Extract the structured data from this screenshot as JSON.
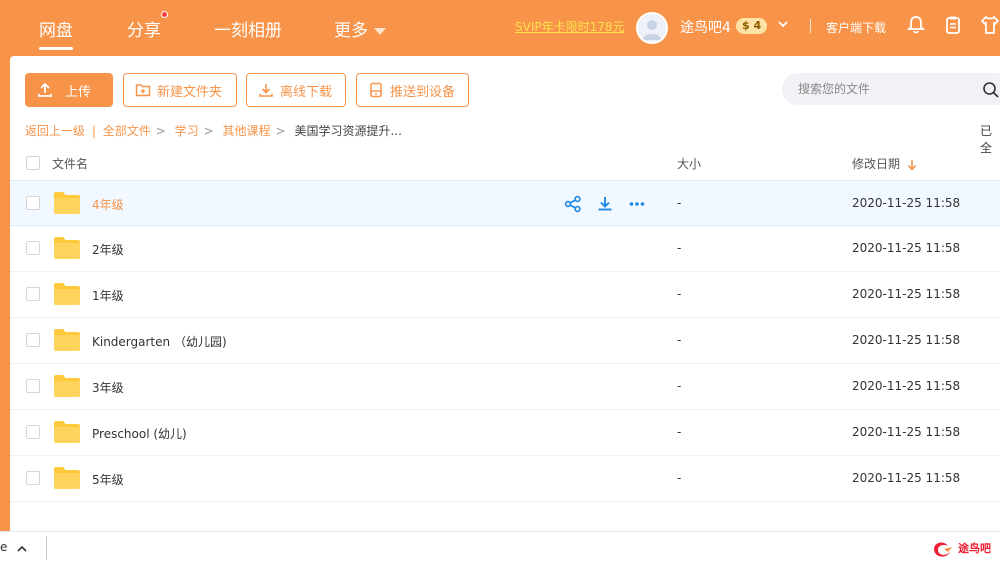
{
  "nav": {
    "items": [
      "网盘",
      "分享",
      "一刻相册",
      "更多"
    ],
    "promo": "SVIP年卡限时178元",
    "username": "途鸟吧4",
    "coin": "$ 4",
    "client": "客户端下载"
  },
  "toolbar": {
    "upload": "上传",
    "new_folder": "新建文件夹",
    "offline": "离线下载",
    "push": "推送到设备",
    "search_placeholder": "搜索您的文件"
  },
  "breadcrumb": {
    "back": "返回上一级",
    "sep": "|",
    "items": [
      "全部文件",
      "学习",
      "其他课程",
      "美国学习资源提升..."
    ],
    "loaded": "已全"
  },
  "table": {
    "columns": {
      "name": "文件名",
      "size": "大小",
      "date": "修改日期"
    },
    "rows": [
      {
        "name": "4年级",
        "size": "-",
        "date": "2020-11-25 11:58"
      },
      {
        "name": "2年级",
        "size": "-",
        "date": "2020-11-25 11:58"
      },
      {
        "name": "1年级",
        "size": "-",
        "date": "2020-11-25 11:58"
      },
      {
        "name": "Kindergarten （幼儿园)",
        "size": "-",
        "date": "2020-11-25 11:58"
      },
      {
        "name": "3年级",
        "size": "-",
        "date": "2020-11-25 11:58"
      },
      {
        "name": "Preschool (幼儿)",
        "size": "-",
        "date": "2020-11-25 11:58"
      },
      {
        "name": "5年级",
        "size": "-",
        "date": "2020-11-25 11:58"
      }
    ]
  },
  "bottom": {
    "edge_text": "e",
    "watermark": "途鸟吧"
  },
  "colors": {
    "accent": "#f7944a",
    "folder": "#ffc83d",
    "action_blue": "#1e88e5"
  }
}
